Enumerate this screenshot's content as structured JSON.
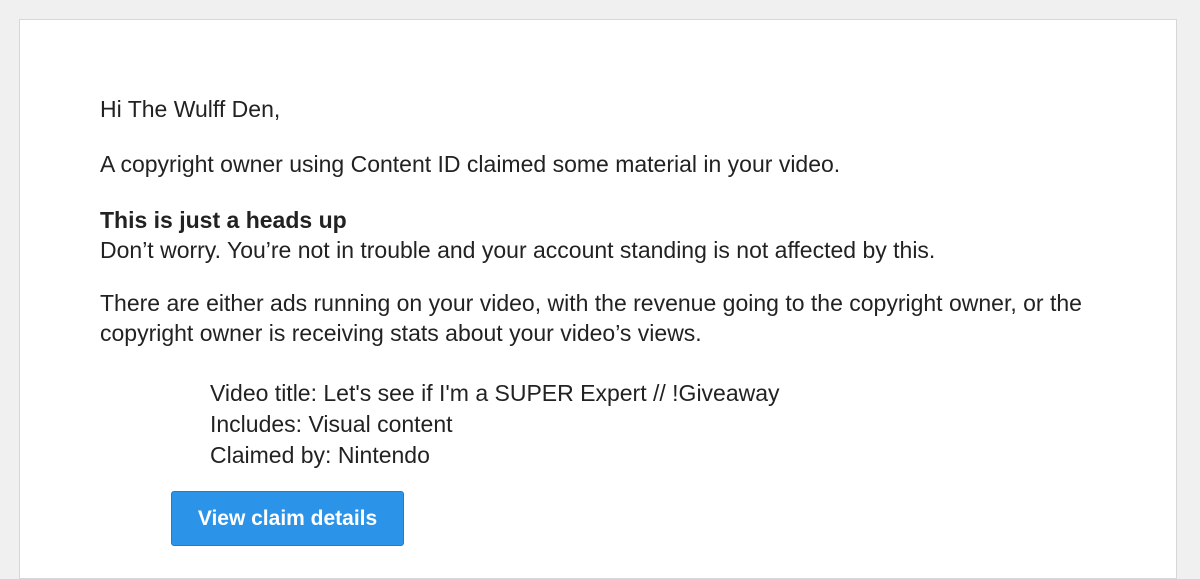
{
  "email": {
    "greeting": "Hi The Wulff Den,",
    "intro": "A copyright owner using Content ID claimed some material in your video.",
    "heads_up_title": "This is just a heads up",
    "heads_up_text": "Don’t worry. You’re not in trouble and your account standing is not affected by this.",
    "revenue_text": "There are either ads running on your video, with the revenue going to the copyright owner, or the copyright owner is receiving stats about your video’s views.",
    "details": {
      "video_title": "Video title: Let's see if I'm a SUPER Expert // !Giveaway",
      "includes": "Includes: Visual content",
      "claimed_by": "Claimed by: Nintendo"
    },
    "button_label": "View claim details"
  },
  "colors": {
    "background": "#f0f0f0",
    "card": "#ffffff",
    "text": "#222222",
    "button": "#2b94e9",
    "button_text": "#ffffff"
  }
}
